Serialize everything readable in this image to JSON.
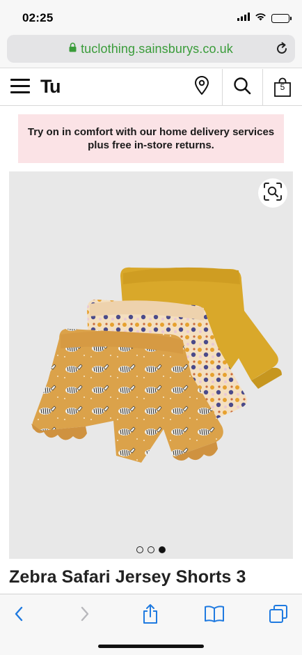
{
  "status_bar": {
    "time": "02:25",
    "icons": [
      "cellular-signal-icon",
      "wifi-icon",
      "battery-icon"
    ],
    "battery_level": 0.6
  },
  "browser": {
    "url": "tuclothing.sainsburys.co.uk",
    "secure_icon": "lock-icon",
    "reload_icon": "reload-icon",
    "url_color": "#3a9c3a"
  },
  "header": {
    "menu_icon": "hamburger-menu-icon",
    "logo": "Tu",
    "store_icon": "location-pin-icon",
    "search_icon": "search-icon",
    "basket_icon": "shopping-bag-icon",
    "basket_count": "5"
  },
  "promo": {
    "text": "Try on in comfort with our home delivery services plus free in-store returns.",
    "background": "#fbe3e6"
  },
  "gallery": {
    "zoom_icon": "zoom-scan-icon",
    "image_count": 3,
    "active_index": 2
  },
  "product": {
    "title": "Zebra Safari Jersey Shorts 3"
  },
  "toolbar": {
    "items": [
      "back-icon",
      "forward-icon",
      "share-icon",
      "bookmarks-icon",
      "tabs-icon"
    ],
    "accent": "#1f7ae0"
  }
}
